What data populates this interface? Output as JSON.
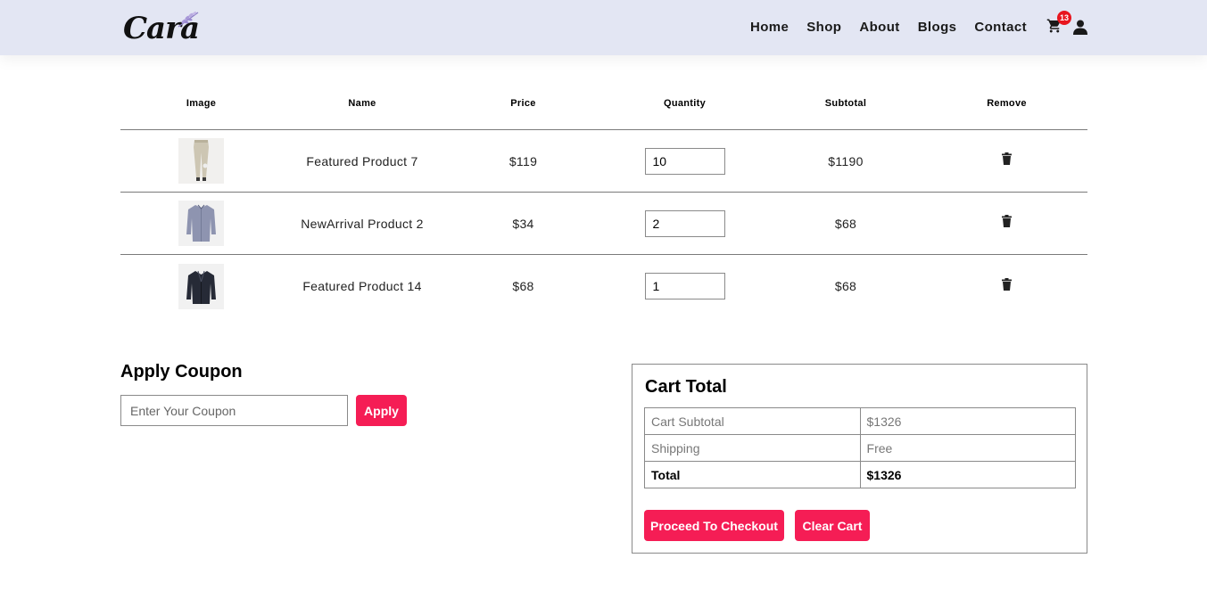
{
  "brand": {
    "logo_text": "Cara",
    "accent": "#f51d55",
    "header_bg": "#e3e6f3"
  },
  "nav": {
    "links": [
      "Home",
      "Shop",
      "About",
      "Blogs",
      "Contact"
    ],
    "cart_count": "13"
  },
  "table": {
    "headers": [
      "Image",
      "Name",
      "Price",
      "Quantity",
      "Subtotal",
      "Remove"
    ],
    "rows": [
      {
        "name": "Featured Product 7",
        "price": "$119",
        "quantity": "10",
        "subtotal": "$1190",
        "image": "beige-pants"
      },
      {
        "name": "NewArrival Product 2",
        "price": "$34",
        "quantity": "2",
        "subtotal": "$68",
        "image": "blue-shirt"
      },
      {
        "name": "Featured Product 14",
        "price": "$68",
        "quantity": "1",
        "subtotal": "$68",
        "image": "dark-jacket"
      }
    ]
  },
  "coupon": {
    "title": "Apply Coupon",
    "placeholder": "Enter Your Coupon",
    "button": "Apply"
  },
  "cart_total": {
    "title": "Cart Total",
    "rows": [
      {
        "label": "Cart Subtotal",
        "value": "$1326"
      },
      {
        "label": "Shipping",
        "value": "Free"
      },
      {
        "label": "Total",
        "value": "$1326"
      }
    ],
    "checkout_button": "Proceed To Checkout",
    "clear_button": "Clear Cart"
  }
}
